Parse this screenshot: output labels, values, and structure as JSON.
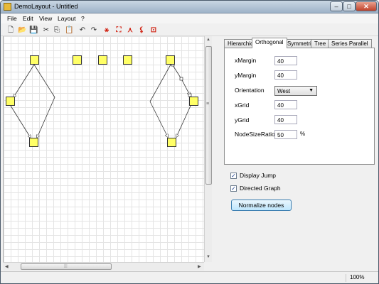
{
  "window": {
    "title": "DemoLayout - Untitled",
    "minimize": "–",
    "maximize": "□",
    "close": "✕"
  },
  "menu": [
    "File",
    "Edit",
    "View",
    "Layout",
    "?"
  ],
  "toolbar": {
    "icons": [
      "new-icon",
      "open-icon",
      "save-icon",
      "cut-icon",
      "copy-icon",
      "paste-icon",
      "undo-icon",
      "redo-icon",
      "layout-icon-1",
      "layout-icon-2",
      "layout-icon-3",
      "layout-icon-4",
      "layout-icon-5"
    ],
    "glyphs": [
      "🗋",
      "📂",
      "💾",
      "✂",
      "⎘",
      "📋",
      "↶",
      "↷",
      "⚹",
      "⛶",
      "⋏",
      "⚸",
      "⊡"
    ]
  },
  "tabs": [
    "Hierarchic",
    "Orthogonal",
    "Symmetric",
    "Tree",
    "Series Parallel"
  ],
  "active_tab": "Orthogonal",
  "settings": {
    "xMargin": {
      "label": "xMargin",
      "value": "40"
    },
    "yMargin": {
      "label": "yMargin",
      "value": "40"
    },
    "orientation": {
      "label": "Orientation",
      "value": "West"
    },
    "xGrid": {
      "label": "xGrid",
      "value": "40"
    },
    "yGrid": {
      "label": "yGrid",
      "value": "40"
    },
    "nodeSizeRatio": {
      "label": "NodeSizeRatio",
      "value": "50",
      "suffix": "%"
    }
  },
  "checkboxes": {
    "display_jump": {
      "label": "Display Jump",
      "checked": true,
      "mark": "✓"
    },
    "directed_graph": {
      "label": "Directed Graph",
      "checked": true,
      "mark": "✓"
    }
  },
  "normalize_button": "Normalize nodes",
  "status": {
    "zoom": "100%"
  },
  "colors": {
    "node_fill": "#ffff66",
    "accent": "#3c7fb1",
    "close_button": "#c0412a"
  }
}
